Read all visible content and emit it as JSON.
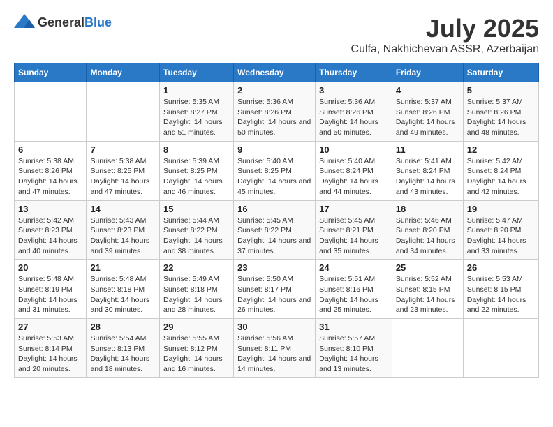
{
  "logo": {
    "text_general": "General",
    "text_blue": "Blue"
  },
  "title": "July 2025",
  "subtitle": "Culfa, Nakhichevan ASSR, Azerbaijan",
  "days_of_week": [
    "Sunday",
    "Monday",
    "Tuesday",
    "Wednesday",
    "Thursday",
    "Friday",
    "Saturday"
  ],
  "weeks": [
    [
      {
        "day": "",
        "sunrise": "",
        "sunset": "",
        "daylight": ""
      },
      {
        "day": "",
        "sunrise": "",
        "sunset": "",
        "daylight": ""
      },
      {
        "day": "1",
        "sunrise": "Sunrise: 5:35 AM",
        "sunset": "Sunset: 8:27 PM",
        "daylight": "Daylight: 14 hours and 51 minutes."
      },
      {
        "day": "2",
        "sunrise": "Sunrise: 5:36 AM",
        "sunset": "Sunset: 8:26 PM",
        "daylight": "Daylight: 14 hours and 50 minutes."
      },
      {
        "day": "3",
        "sunrise": "Sunrise: 5:36 AM",
        "sunset": "Sunset: 8:26 PM",
        "daylight": "Daylight: 14 hours and 50 minutes."
      },
      {
        "day": "4",
        "sunrise": "Sunrise: 5:37 AM",
        "sunset": "Sunset: 8:26 PM",
        "daylight": "Daylight: 14 hours and 49 minutes."
      },
      {
        "day": "5",
        "sunrise": "Sunrise: 5:37 AM",
        "sunset": "Sunset: 8:26 PM",
        "daylight": "Daylight: 14 hours and 48 minutes."
      }
    ],
    [
      {
        "day": "6",
        "sunrise": "Sunrise: 5:38 AM",
        "sunset": "Sunset: 8:26 PM",
        "daylight": "Daylight: 14 hours and 47 minutes."
      },
      {
        "day": "7",
        "sunrise": "Sunrise: 5:38 AM",
        "sunset": "Sunset: 8:25 PM",
        "daylight": "Daylight: 14 hours and 47 minutes."
      },
      {
        "day": "8",
        "sunrise": "Sunrise: 5:39 AM",
        "sunset": "Sunset: 8:25 PM",
        "daylight": "Daylight: 14 hours and 46 minutes."
      },
      {
        "day": "9",
        "sunrise": "Sunrise: 5:40 AM",
        "sunset": "Sunset: 8:25 PM",
        "daylight": "Daylight: 14 hours and 45 minutes."
      },
      {
        "day": "10",
        "sunrise": "Sunrise: 5:40 AM",
        "sunset": "Sunset: 8:24 PM",
        "daylight": "Daylight: 14 hours and 44 minutes."
      },
      {
        "day": "11",
        "sunrise": "Sunrise: 5:41 AM",
        "sunset": "Sunset: 8:24 PM",
        "daylight": "Daylight: 14 hours and 43 minutes."
      },
      {
        "day": "12",
        "sunrise": "Sunrise: 5:42 AM",
        "sunset": "Sunset: 8:24 PM",
        "daylight": "Daylight: 14 hours and 42 minutes."
      }
    ],
    [
      {
        "day": "13",
        "sunrise": "Sunrise: 5:42 AM",
        "sunset": "Sunset: 8:23 PM",
        "daylight": "Daylight: 14 hours and 40 minutes."
      },
      {
        "day": "14",
        "sunrise": "Sunrise: 5:43 AM",
        "sunset": "Sunset: 8:23 PM",
        "daylight": "Daylight: 14 hours and 39 minutes."
      },
      {
        "day": "15",
        "sunrise": "Sunrise: 5:44 AM",
        "sunset": "Sunset: 8:22 PM",
        "daylight": "Daylight: 14 hours and 38 minutes."
      },
      {
        "day": "16",
        "sunrise": "Sunrise: 5:45 AM",
        "sunset": "Sunset: 8:22 PM",
        "daylight": "Daylight: 14 hours and 37 minutes."
      },
      {
        "day": "17",
        "sunrise": "Sunrise: 5:45 AM",
        "sunset": "Sunset: 8:21 PM",
        "daylight": "Daylight: 14 hours and 35 minutes."
      },
      {
        "day": "18",
        "sunrise": "Sunrise: 5:46 AM",
        "sunset": "Sunset: 8:20 PM",
        "daylight": "Daylight: 14 hours and 34 minutes."
      },
      {
        "day": "19",
        "sunrise": "Sunrise: 5:47 AM",
        "sunset": "Sunset: 8:20 PM",
        "daylight": "Daylight: 14 hours and 33 minutes."
      }
    ],
    [
      {
        "day": "20",
        "sunrise": "Sunrise: 5:48 AM",
        "sunset": "Sunset: 8:19 PM",
        "daylight": "Daylight: 14 hours and 31 minutes."
      },
      {
        "day": "21",
        "sunrise": "Sunrise: 5:48 AM",
        "sunset": "Sunset: 8:18 PM",
        "daylight": "Daylight: 14 hours and 30 minutes."
      },
      {
        "day": "22",
        "sunrise": "Sunrise: 5:49 AM",
        "sunset": "Sunset: 8:18 PM",
        "daylight": "Daylight: 14 hours and 28 minutes."
      },
      {
        "day": "23",
        "sunrise": "Sunrise: 5:50 AM",
        "sunset": "Sunset: 8:17 PM",
        "daylight": "Daylight: 14 hours and 26 minutes."
      },
      {
        "day": "24",
        "sunrise": "Sunrise: 5:51 AM",
        "sunset": "Sunset: 8:16 PM",
        "daylight": "Daylight: 14 hours and 25 minutes."
      },
      {
        "day": "25",
        "sunrise": "Sunrise: 5:52 AM",
        "sunset": "Sunset: 8:15 PM",
        "daylight": "Daylight: 14 hours and 23 minutes."
      },
      {
        "day": "26",
        "sunrise": "Sunrise: 5:53 AM",
        "sunset": "Sunset: 8:15 PM",
        "daylight": "Daylight: 14 hours and 22 minutes."
      }
    ],
    [
      {
        "day": "27",
        "sunrise": "Sunrise: 5:53 AM",
        "sunset": "Sunset: 8:14 PM",
        "daylight": "Daylight: 14 hours and 20 minutes."
      },
      {
        "day": "28",
        "sunrise": "Sunrise: 5:54 AM",
        "sunset": "Sunset: 8:13 PM",
        "daylight": "Daylight: 14 hours and 18 minutes."
      },
      {
        "day": "29",
        "sunrise": "Sunrise: 5:55 AM",
        "sunset": "Sunset: 8:12 PM",
        "daylight": "Daylight: 14 hours and 16 minutes."
      },
      {
        "day": "30",
        "sunrise": "Sunrise: 5:56 AM",
        "sunset": "Sunset: 8:11 PM",
        "daylight": "Daylight: 14 hours and 14 minutes."
      },
      {
        "day": "31",
        "sunrise": "Sunrise: 5:57 AM",
        "sunset": "Sunset: 8:10 PM",
        "daylight": "Daylight: 14 hours and 13 minutes."
      },
      {
        "day": "",
        "sunrise": "",
        "sunset": "",
        "daylight": ""
      },
      {
        "day": "",
        "sunrise": "",
        "sunset": "",
        "daylight": ""
      }
    ]
  ]
}
